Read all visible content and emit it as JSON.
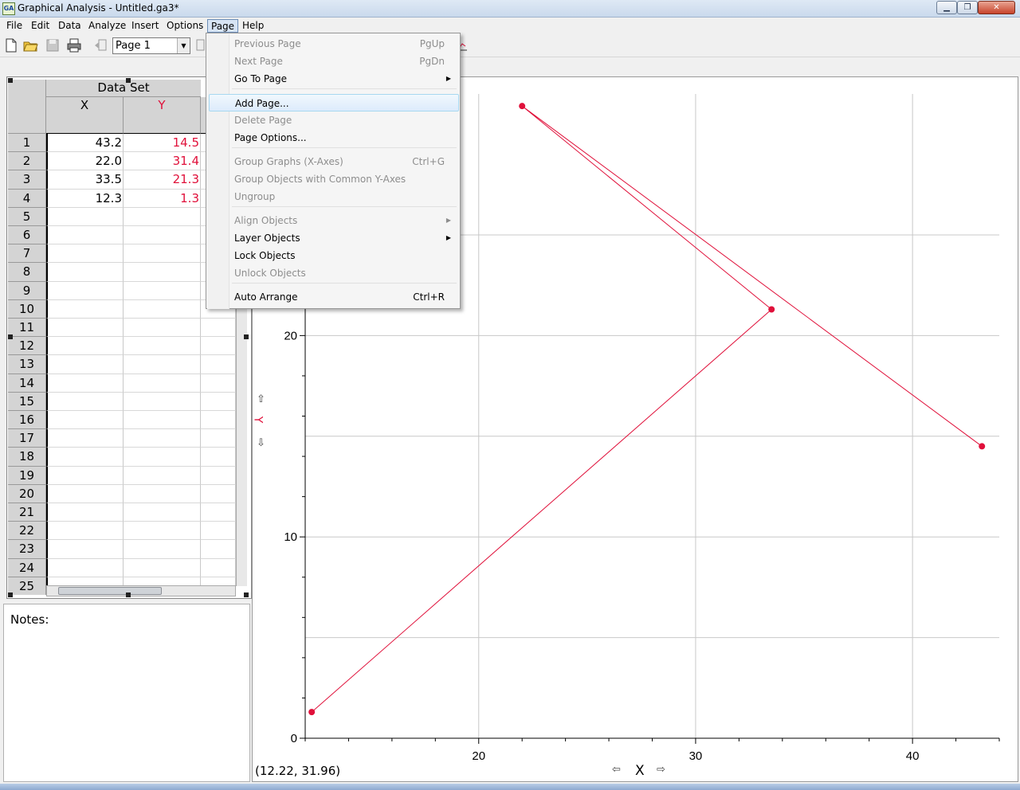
{
  "window": {
    "title": "Graphical Analysis - Untitled.ga3*",
    "icon_text": "GA",
    "minimize": "▁",
    "maximize": "❐",
    "close": "✕"
  },
  "menubar": {
    "items": [
      "File",
      "Edit",
      "Data",
      "Analyze",
      "Insert",
      "Options",
      "Page",
      "Help"
    ]
  },
  "toolbar": {
    "page_select": "Page 1",
    "dropdown_arrow": "▼"
  },
  "data_table": {
    "title": "Data Set",
    "columns": [
      "X",
      "Y"
    ],
    "rows": [
      {
        "n": "1",
        "x": "43.2",
        "y": "14.5"
      },
      {
        "n": "2",
        "x": "22.0",
        "y": "31.4"
      },
      {
        "n": "3",
        "x": "33.5",
        "y": "21.3"
      },
      {
        "n": "4",
        "x": "12.3",
        "y": "1.3"
      },
      {
        "n": "5",
        "x": "",
        "y": ""
      },
      {
        "n": "6",
        "x": "",
        "y": ""
      },
      {
        "n": "7",
        "x": "",
        "y": ""
      },
      {
        "n": "8",
        "x": "",
        "y": ""
      },
      {
        "n": "9",
        "x": "",
        "y": ""
      },
      {
        "n": "10",
        "x": "",
        "y": ""
      },
      {
        "n": "11",
        "x": "",
        "y": ""
      },
      {
        "n": "12",
        "x": "",
        "y": ""
      },
      {
        "n": "13",
        "x": "",
        "y": ""
      },
      {
        "n": "14",
        "x": "",
        "y": ""
      },
      {
        "n": "15",
        "x": "",
        "y": ""
      },
      {
        "n": "16",
        "x": "",
        "y": ""
      },
      {
        "n": "17",
        "x": "",
        "y": ""
      },
      {
        "n": "18",
        "x": "",
        "y": ""
      },
      {
        "n": "19",
        "x": "",
        "y": ""
      },
      {
        "n": "20",
        "x": "",
        "y": ""
      },
      {
        "n": "21",
        "x": "",
        "y": ""
      },
      {
        "n": "22",
        "x": "",
        "y": ""
      },
      {
        "n": "23",
        "x": "",
        "y": ""
      },
      {
        "n": "24",
        "x": "",
        "y": ""
      },
      {
        "n": "25",
        "x": "",
        "y": ""
      }
    ]
  },
  "notes": {
    "label": "Notes:"
  },
  "graph": {
    "coordinate_readout": "(12.22, 31.96)",
    "x_label": "X",
    "y_label": "Y",
    "x_left_arrow": "⇦",
    "x_right_arrow": "⇨",
    "y_up_arrow": "⇧",
    "y_down_arrow": "⇩"
  },
  "chart_data": {
    "type": "line",
    "series": [
      {
        "color": "#e0103a",
        "x": [
          43.2,
          22.0,
          33.5,
          12.3
        ],
        "y": [
          14.5,
          31.4,
          21.3,
          1.3
        ]
      }
    ],
    "xlabel": "X",
    "ylabel": "Y",
    "xlim": [
      12,
      44
    ],
    "ylim": [
      0,
      32
    ],
    "x_ticks": [
      "20",
      "30",
      "40"
    ],
    "y_ticks": [
      "0",
      "10",
      "20"
    ],
    "grid": true
  },
  "page_menu": {
    "items": [
      {
        "label": "Previous Page",
        "shortcut": "PgUp",
        "enabled": false,
        "submenu": false
      },
      {
        "label": "Next Page",
        "shortcut": "PgDn",
        "enabled": false,
        "submenu": false
      },
      {
        "label": "Go To Page",
        "shortcut": "",
        "enabled": true,
        "submenu": true
      },
      {
        "label": "Add Page...",
        "shortcut": "",
        "enabled": true,
        "submenu": false,
        "highlighted": true
      },
      {
        "label": "Delete Page",
        "shortcut": "",
        "enabled": false,
        "submenu": false
      },
      {
        "label": "Page Options...",
        "shortcut": "",
        "enabled": true,
        "submenu": false
      },
      {
        "label": "Group Graphs (X-Axes)",
        "shortcut": "Ctrl+G",
        "enabled": false,
        "submenu": false
      },
      {
        "label": "Group Objects with Common Y-Axes",
        "shortcut": "",
        "enabled": false,
        "submenu": false
      },
      {
        "label": "Ungroup",
        "shortcut": "",
        "enabled": false,
        "submenu": false
      },
      {
        "label": "Align Objects",
        "shortcut": "",
        "enabled": false,
        "submenu": true
      },
      {
        "label": "Layer Objects",
        "shortcut": "",
        "enabled": true,
        "submenu": true
      },
      {
        "label": "Lock Objects",
        "shortcut": "",
        "enabled": true,
        "submenu": false
      },
      {
        "label": "Unlock Objects",
        "shortcut": "",
        "enabled": false,
        "submenu": false
      },
      {
        "label": "Auto Arrange",
        "shortcut": "Ctrl+R",
        "enabled": true,
        "submenu": false
      }
    ],
    "submenu_glyph": "▶"
  }
}
